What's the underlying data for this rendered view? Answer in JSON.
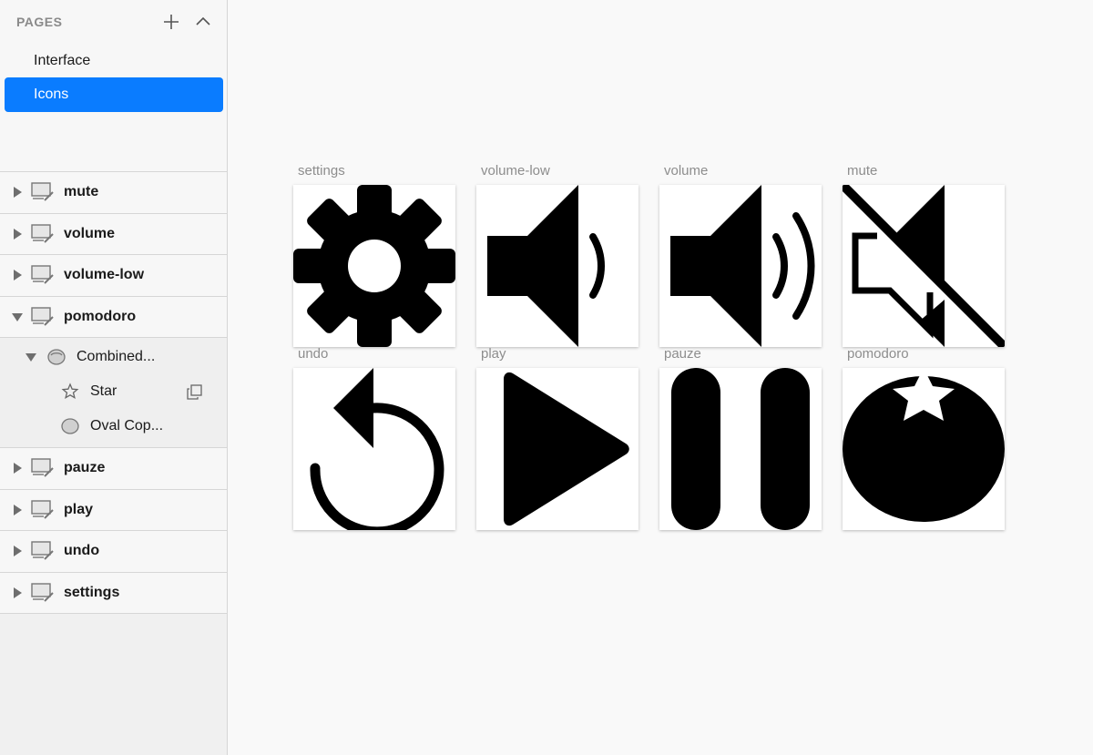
{
  "sidebar": {
    "pages_title": "PAGES",
    "pages": [
      {
        "label": "Interface"
      },
      {
        "label": "Icons"
      }
    ],
    "layers": [
      {
        "label": "mute"
      },
      {
        "label": "volume"
      },
      {
        "label": "volume-low"
      },
      {
        "label": "pomodoro"
      },
      {
        "label": "pauze"
      },
      {
        "label": "play"
      },
      {
        "label": "undo"
      },
      {
        "label": "settings"
      }
    ],
    "pomodoro_children": {
      "group": "Combined...",
      "star": "Star",
      "oval": "Oval Cop..."
    }
  },
  "artboards": [
    {
      "label": "settings"
    },
    {
      "label": "volume-low"
    },
    {
      "label": "volume"
    },
    {
      "label": "mute"
    },
    {
      "label": "undo"
    },
    {
      "label": "play"
    },
    {
      "label": "pauze"
    },
    {
      "label": "pomodoro"
    }
  ]
}
